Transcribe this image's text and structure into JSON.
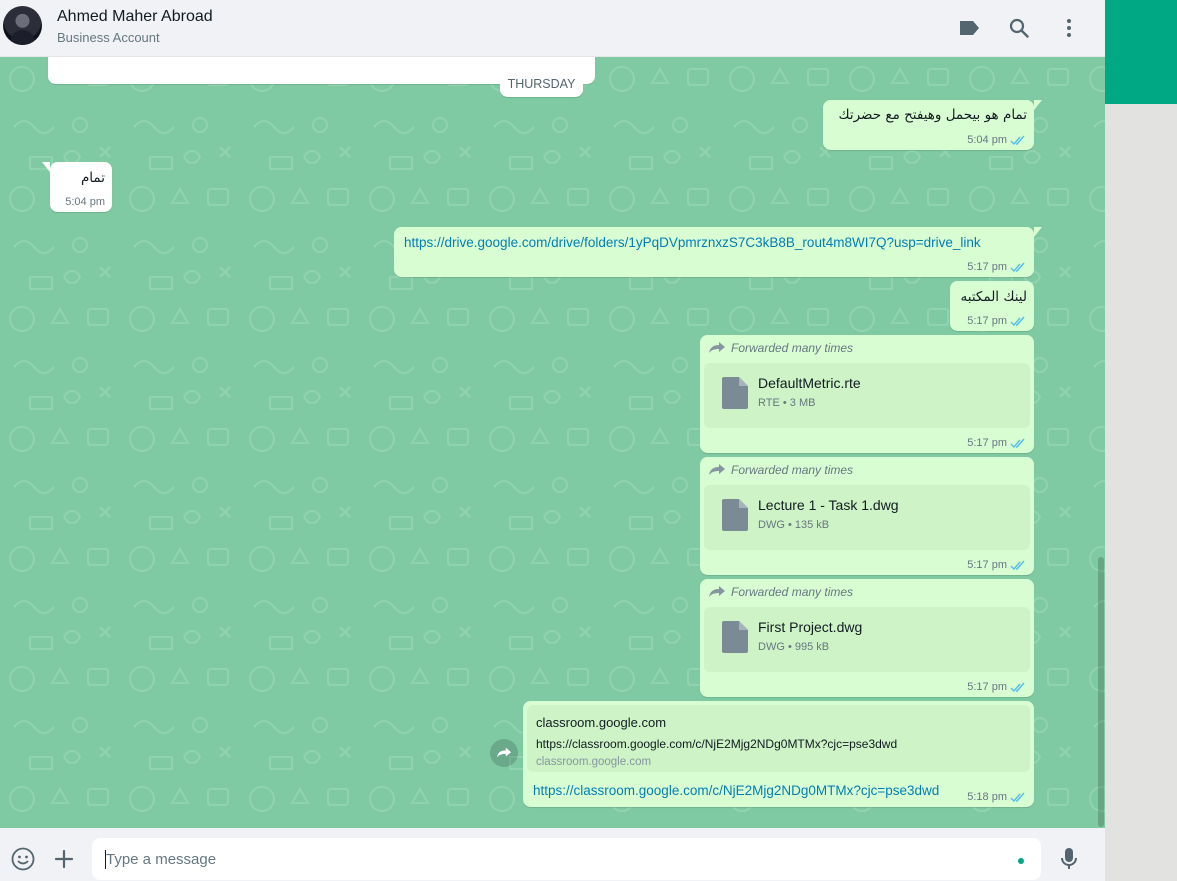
{
  "header": {
    "contact_name": "Ahmed Maher Abroad",
    "contact_subtitle": "Business Account",
    "icons": [
      "label-icon",
      "search-icon",
      "menu-icon"
    ]
  },
  "date_chip": "THURSDAY",
  "messages": [
    {
      "direction": "out",
      "text": "تمام هو بيحمل وهيفتح مع حضرتك",
      "time": "5:04 pm",
      "status": "read"
    },
    {
      "direction": "in",
      "text": "تمام",
      "time": "5:04 pm"
    },
    {
      "direction": "out",
      "text": "https://drive.google.com/drive/folders/1yPqDVpmrznxzS7C3kB8B_rout4m8WI7Q?usp=drive_link",
      "time": "5:17 pm",
      "status": "read"
    },
    {
      "direction": "out",
      "text": "لينك المكتبه",
      "time": "5:17 pm",
      "status": "read"
    },
    {
      "direction": "out",
      "forwarded_label": "Forwarded many times",
      "file_name": "DefaultMetric.rte",
      "file_type": "RTE",
      "file_size": "3 MB",
      "time": "5:17 pm",
      "status": "read"
    },
    {
      "direction": "out",
      "forwarded_label": "Forwarded many times",
      "file_name": "Lecture 1 - Task 1.dwg",
      "file_type": "DWG",
      "file_size": "135 kB",
      "time": "5:17 pm",
      "status": "read"
    },
    {
      "direction": "out",
      "forwarded_label": "Forwarded many times",
      "file_name": "First Project.dwg",
      "file_type": "DWG",
      "file_size": "995 kB",
      "time": "5:17 pm",
      "status": "read"
    },
    {
      "direction": "out",
      "preview_title": "classroom.google.com",
      "preview_url": "https://classroom.google.com/c/NjE2Mjg2NDg0MTMx?cjc=pse3dwd",
      "preview_domain": "classroom.google.com",
      "text": "https://classroom.google.com/c/NjE2Mjg2NDg0MTMx?cjc=pse3dwd",
      "time": "5:18 pm",
      "status": "read"
    }
  ],
  "footer": {
    "placeholder": "Type a message",
    "icons": [
      "emoji-icon",
      "attach-plus-icon",
      "mic-icon"
    ]
  },
  "colors": {
    "accent": "#00a884",
    "chat_background": "#7fcaa2",
    "outgoing_bubble": "#d9fdd3",
    "incoming_bubble": "#ffffff",
    "read_ticks": "#53bdeb",
    "link": "#027eb5"
  }
}
